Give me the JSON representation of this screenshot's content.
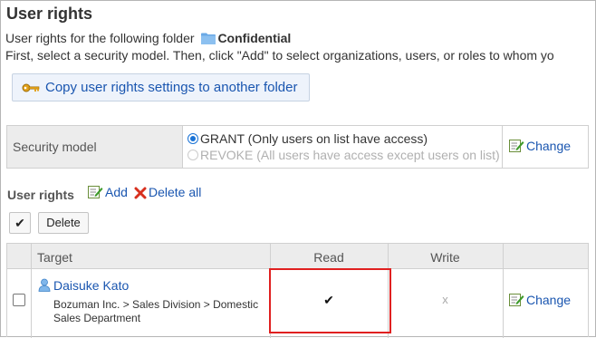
{
  "page": {
    "title": "User rights",
    "intro_prefix": "User rights for the following folder",
    "folder_name": "Confidential",
    "instructions": "First, select a security model. Then, click \"Add\" to select organizations, users, or roles to whom yo"
  },
  "copy_button": {
    "label": "Copy user rights settings to another folder",
    "icon": "key-icon"
  },
  "security_model": {
    "label": "Security model",
    "options": [
      {
        "label": "GRANT (Only users on list have access)",
        "selected": true,
        "enabled": true
      },
      {
        "label": "REVOKE (All users have access except users on list)",
        "selected": false,
        "enabled": false
      }
    ],
    "change_label": "Change"
  },
  "user_rights": {
    "title": "User rights",
    "add_label": "Add",
    "delete_all_label": "Delete all",
    "select_all_glyph": "✔",
    "delete_label": "Delete",
    "columns": {
      "target": "Target",
      "read": "Read",
      "write": "Write"
    },
    "rows": [
      {
        "name": "Daisuke Kato",
        "path": "Bozuman Inc. > Sales Division > Domestic Sales Department",
        "read": "✔",
        "write": "x",
        "change_label": "Change"
      }
    ]
  },
  "colors": {
    "link": "#1a56b0",
    "highlight": "#e02020",
    "header_bg": "#ececec",
    "button_bg": "#eef3fb"
  }
}
